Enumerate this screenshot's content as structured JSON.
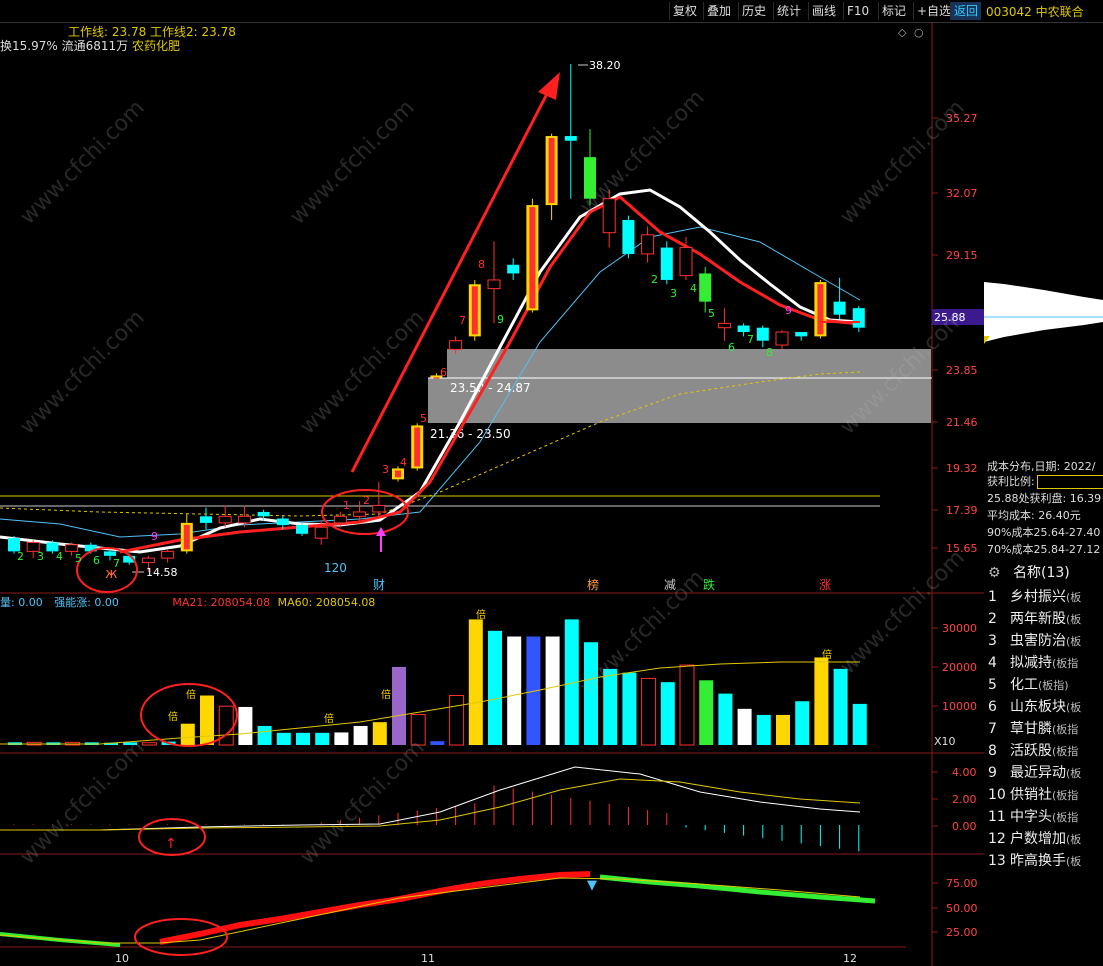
{
  "toolbar": {
    "buttons": [
      "复权",
      "叠加",
      "历史",
      "统计",
      "画线",
      "F10",
      "标记",
      "+自选",
      "返回"
    ],
    "active": "返回",
    "stock": "003042 中农联合"
  },
  "header": {
    "work_lines": "工作线: 23.78  工作线2: 23.78",
    "info_prefix": "换15.97% 流通6811万 ",
    "sector": "农药化肥"
  },
  "price_panel": {
    "yticks": [
      "35.27",
      "32.07",
      "29.15",
      "23.85",
      "21.46",
      "19.32",
      "17.39",
      "15.65"
    ],
    "current_price": "25.88",
    "high_label": "38.20",
    "low_label": "14.58",
    "zone_upper": "23.50 - 24.87",
    "zone_lower": "21.36 - 23.50",
    "count_120": "120",
    "event_marks": [
      "财",
      "榜",
      "减",
      "跌",
      "涨"
    ]
  },
  "volume_panel": {
    "labels": [
      "量: 0.00",
      "强能涨: 0.00",
      "MA21: 208054.08",
      "MA60: 208054.08"
    ],
    "yticks": [
      "30000",
      "20000",
      "10000"
    ],
    "unit": "X10",
    "bei": "倍"
  },
  "macd_panel": {
    "yticks": [
      "4.00",
      "2.00",
      "0.00"
    ]
  },
  "kdj_panel": {
    "yticks": [
      "75.00",
      "50.00",
      "25.00"
    ]
  },
  "x_axis": {
    "labels": [
      "10",
      "11",
      "12"
    ]
  },
  "side_panel": {
    "cost_title": "成本分布,日期: 2022/",
    "profit_ratio": "获利比例:",
    "profit_line": "25.88处获利盘: 16.39",
    "avg_cost": "平均成本: 26.40元",
    "cost90": "90%成本25.64-27.40",
    "cost70": "70%成本25.84-27.12",
    "sector_header": "名称(13)",
    "sectors": [
      {
        "no": "1",
        "name": "乡村振兴",
        "tag": "(板"
      },
      {
        "no": "2",
        "name": "两年新股",
        "tag": "(板"
      },
      {
        "no": "3",
        "name": "虫害防治",
        "tag": "(板"
      },
      {
        "no": "4",
        "name": "拟减持",
        "tag": "(板指"
      },
      {
        "no": "5",
        "name": "化工",
        "tag": "(板指)"
      },
      {
        "no": "6",
        "name": "山东板块",
        "tag": "(板"
      },
      {
        "no": "7",
        "name": "草甘膦",
        "tag": "(板指"
      },
      {
        "no": "8",
        "name": "活跃股",
        "tag": "(板指"
      },
      {
        "no": "9",
        "name": "最近异动",
        "tag": "(板"
      },
      {
        "no": "10",
        "name": "供销社",
        "tag": "(板指"
      },
      {
        "no": "11",
        "name": "中字头",
        "tag": "(板指"
      },
      {
        "no": "12",
        "name": "户数增加",
        "tag": "(板"
      },
      {
        "no": "13",
        "name": "昨高换手",
        "tag": "(板"
      }
    ]
  },
  "watermark": "www.cfchi.com",
  "chart_data": {
    "type": "candlestick",
    "y_range": [
      14.5,
      39.0
    ],
    "candles": [
      {
        "o": 16.1,
        "h": 16.2,
        "l": 15.4,
        "c": 15.5,
        "color": "cyan"
      },
      {
        "o": 15.5,
        "h": 16.0,
        "l": 15.2,
        "c": 15.9,
        "color": "red"
      },
      {
        "o": 15.9,
        "h": 16.0,
        "l": 15.4,
        "c": 15.5,
        "color": "cyan"
      },
      {
        "o": 15.5,
        "h": 15.9,
        "l": 15.3,
        "c": 15.8,
        "color": "red"
      },
      {
        "o": 15.8,
        "h": 15.9,
        "l": 15.4,
        "c": 15.5,
        "color": "cyan"
      },
      {
        "o": 15.5,
        "h": 15.6,
        "l": 15.1,
        "c": 15.3,
        "color": "cyan"
      },
      {
        "o": 15.3,
        "h": 15.4,
        "l": 14.9,
        "c": 15.0,
        "color": "cyan"
      },
      {
        "o": 15.0,
        "h": 15.3,
        "l": 14.58,
        "c": 15.2,
        "color": "red"
      },
      {
        "o": 15.2,
        "h": 15.6,
        "l": 15.0,
        "c": 15.5,
        "color": "red"
      },
      {
        "o": 15.5,
        "h": 17.2,
        "l": 15.4,
        "c": 16.8,
        "color": "yellow"
      },
      {
        "o": 16.8,
        "h": 17.5,
        "l": 16.5,
        "c": 17.1,
        "color": "cyan"
      },
      {
        "o": 17.1,
        "h": 17.6,
        "l": 16.6,
        "c": 16.8,
        "color": "red"
      },
      {
        "o": 16.8,
        "h": 17.6,
        "l": 16.6,
        "c": 17.1,
        "color": "red"
      },
      {
        "o": 17.1,
        "h": 17.4,
        "l": 16.9,
        "c": 17.3,
        "color": "cyan"
      },
      {
        "o": 17.0,
        "h": 17.1,
        "l": 16.5,
        "c": 16.7,
        "color": "cyan"
      },
      {
        "o": 16.7,
        "h": 16.8,
        "l": 16.2,
        "c": 16.3,
        "color": "cyan"
      },
      {
        "o": 16.1,
        "h": 16.9,
        "l": 15.8,
        "c": 16.6,
        "color": "red"
      },
      {
        "o": 16.8,
        "h": 17.3,
        "l": 16.6,
        "c": 17.1,
        "color": "red"
      },
      {
        "o": 17.1,
        "h": 17.8,
        "l": 16.9,
        "c": 17.3,
        "color": "red"
      },
      {
        "o": 17.3,
        "h": 18.7,
        "l": 17.0,
        "c": 17.6,
        "color": "red"
      },
      {
        "o": 18.8,
        "h": 19.4,
        "l": 18.7,
        "c": 19.3,
        "color": "yellow"
      },
      {
        "o": 19.3,
        "h": 21.4,
        "l": 19.2,
        "c": 21.3,
        "color": "yellow"
      },
      {
        "o": 23.6,
        "h": 23.7,
        "l": 23.5,
        "c": 23.6,
        "color": "yellow"
      },
      {
        "o": 24.8,
        "h": 25.4,
        "l": 24.6,
        "c": 25.2,
        "color": "red"
      },
      {
        "o": 25.4,
        "h": 28.0,
        "l": 25.2,
        "c": 27.8,
        "color": "yellow"
      },
      {
        "o": 28.0,
        "h": 29.8,
        "l": 26.0,
        "c": 27.6,
        "color": "red"
      },
      {
        "o": 28.7,
        "h": 29.0,
        "l": 28.0,
        "c": 28.3,
        "color": "cyan"
      },
      {
        "o": 26.6,
        "h": 31.8,
        "l": 26.5,
        "c": 31.5,
        "color": "yellow"
      },
      {
        "o": 31.5,
        "h": 34.6,
        "l": 30.8,
        "c": 34.5,
        "color": "yellow"
      },
      {
        "o": 34.3,
        "h": 38.2,
        "l": 31.8,
        "c": 34.5,
        "color": "cyan"
      },
      {
        "o": 33.6,
        "h": 34.8,
        "l": 31.5,
        "c": 31.8,
        "color": "green"
      },
      {
        "o": 31.8,
        "h": 32.2,
        "l": 29.5,
        "c": 30.2,
        "color": "red"
      },
      {
        "o": 30.8,
        "h": 31.0,
        "l": 29.0,
        "c": 29.2,
        "color": "cyan"
      },
      {
        "o": 29.2,
        "h": 30.5,
        "l": 28.8,
        "c": 30.1,
        "color": "red"
      },
      {
        "o": 29.5,
        "h": 29.8,
        "l": 27.8,
        "c": 28.0,
        "color": "cyan"
      },
      {
        "o": 28.2,
        "h": 30.0,
        "l": 28.0,
        "c": 29.5,
        "color": "red"
      },
      {
        "o": 28.3,
        "h": 28.6,
        "l": 26.5,
        "c": 27.0,
        "color": "green"
      },
      {
        "o": 26.0,
        "h": 26.7,
        "l": 25.2,
        "c": 25.8,
        "color": "red"
      },
      {
        "o": 25.6,
        "h": 26.0,
        "l": 25.4,
        "c": 25.9,
        "color": "cyan"
      },
      {
        "o": 25.8,
        "h": 25.9,
        "l": 24.9,
        "c": 25.2,
        "color": "cyan"
      },
      {
        "o": 25.6,
        "h": 25.7,
        "l": 24.8,
        "c": 25.0,
        "color": "red"
      },
      {
        "o": 25.4,
        "h": 25.6,
        "l": 25.2,
        "c": 25.6,
        "color": "cyan"
      },
      {
        "o": 25.4,
        "h": 28.0,
        "l": 25.3,
        "c": 27.9,
        "color": "yellow"
      },
      {
        "o": 27.0,
        "h": 28.1,
        "l": 26.2,
        "c": 26.4,
        "color": "cyan"
      },
      {
        "o": 26.7,
        "h": 26.8,
        "l": 25.6,
        "c": 25.8,
        "color": "cyan"
      }
    ],
    "volume": [
      700,
      700,
      700,
      700,
      700,
      600,
      700,
      600,
      900,
      5600,
      13000,
      10200,
      10000,
      5000,
      3200,
      3200,
      3200,
      3300,
      5000,
      6000,
      20500,
      8000,
      1000,
      13000,
      33000,
      30000,
      28500,
      28500,
      28500,
      33000,
      27000,
      20000,
      19000,
      17500,
      16500,
      21000,
      17000,
      13500,
      9500,
      7900,
      7900,
      11500,
      23000,
      20000,
      10800
    ],
    "volume_colors": [
      "cyan",
      "red",
      "cyan",
      "red",
      "cyan",
      "cyan",
      "cyan",
      "red",
      "cyan",
      "yellow",
      "yellow",
      "red",
      "white",
      "cyan",
      "cyan",
      "cyan",
      "cyan",
      "white",
      "white",
      "yellow",
      "purple",
      "red",
      "blue",
      "red",
      "yellow",
      "cyan",
      "white",
      "blue",
      "white",
      "cyan",
      "cyan",
      "cyan",
      "cyan",
      "red",
      "cyan",
      "red",
      "green",
      "cyan",
      "white",
      "cyan",
      "yellow",
      "cyan",
      "yellow",
      "cyan",
      "cyan"
    ]
  }
}
